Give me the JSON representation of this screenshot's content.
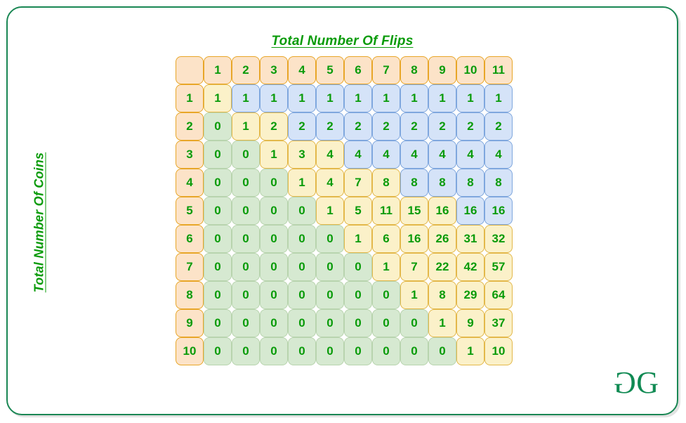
{
  "card": {
    "border_color": "#1a8754",
    "background": "#ffffff"
  },
  "titles": {
    "x_axis": "Total Number Of Flips",
    "y_axis": "Total Number Of Coins",
    "text_color": "#0a9b0a"
  },
  "logo": {
    "left_glyph": "G",
    "right_glyph": "G",
    "color": "#108a53"
  },
  "palette": {
    "header": "#fce3c8",
    "header_border": "#e8a628",
    "zero": "#d6e9d1",
    "zero_border": "#b8d4ae",
    "active": "#fbf1c9",
    "active_border": "#e3b84a",
    "saturated": "#d5e3f8",
    "saturated_border": "#7fa7de",
    "text": "#0a9b0a"
  },
  "chart_data": {
    "type": "table",
    "title": "Total Number Of Flips",
    "xlabel": "Total Number Of Flips",
    "ylabel": "Total Number Of Coins",
    "corner_label": "",
    "column_headers": [
      "1",
      "2",
      "3",
      "4",
      "5",
      "6",
      "7",
      "8",
      "9",
      "10",
      "11"
    ],
    "row_headers": [
      "1",
      "2",
      "3",
      "4",
      "5",
      "6",
      "7",
      "8",
      "9",
      "10"
    ],
    "rows": [
      {
        "coins": "1",
        "values": [
          "1",
          "1",
          "1",
          "1",
          "1",
          "1",
          "1",
          "1",
          "1",
          "1",
          "1"
        ],
        "kinds": [
          "active",
          "saturated",
          "saturated",
          "saturated",
          "saturated",
          "saturated",
          "saturated",
          "saturated",
          "saturated",
          "saturated",
          "saturated"
        ]
      },
      {
        "coins": "2",
        "values": [
          "0",
          "1",
          "2",
          "2",
          "2",
          "2",
          "2",
          "2",
          "2",
          "2",
          "2"
        ],
        "kinds": [
          "zero",
          "active",
          "active",
          "saturated",
          "saturated",
          "saturated",
          "saturated",
          "saturated",
          "saturated",
          "saturated",
          "saturated"
        ]
      },
      {
        "coins": "3",
        "values": [
          "0",
          "0",
          "1",
          "3",
          "4",
          "4",
          "4",
          "4",
          "4",
          "4",
          "4"
        ],
        "kinds": [
          "zero",
          "zero",
          "active",
          "active",
          "active",
          "saturated",
          "saturated",
          "saturated",
          "saturated",
          "saturated",
          "saturated"
        ]
      },
      {
        "coins": "4",
        "values": [
          "0",
          "0",
          "0",
          "1",
          "4",
          "7",
          "8",
          "8",
          "8",
          "8",
          "8"
        ],
        "kinds": [
          "zero",
          "zero",
          "zero",
          "active",
          "active",
          "active",
          "active",
          "saturated",
          "saturated",
          "saturated",
          "saturated"
        ]
      },
      {
        "coins": "5",
        "values": [
          "0",
          "0",
          "0",
          "0",
          "1",
          "5",
          "11",
          "15",
          "16",
          "16",
          "16"
        ],
        "kinds": [
          "zero",
          "zero",
          "zero",
          "zero",
          "active",
          "active",
          "active",
          "active",
          "active",
          "saturated",
          "saturated"
        ]
      },
      {
        "coins": "6",
        "values": [
          "0",
          "0",
          "0",
          "0",
          "0",
          "1",
          "6",
          "16",
          "26",
          "31",
          "32"
        ],
        "kinds": [
          "zero",
          "zero",
          "zero",
          "zero",
          "zero",
          "active",
          "active",
          "active",
          "active",
          "active",
          "active"
        ]
      },
      {
        "coins": "7",
        "values": [
          "0",
          "0",
          "0",
          "0",
          "0",
          "0",
          "1",
          "7",
          "22",
          "42",
          "57"
        ],
        "kinds": [
          "zero",
          "zero",
          "zero",
          "zero",
          "zero",
          "zero",
          "active",
          "active",
          "active",
          "active",
          "active"
        ]
      },
      {
        "coins": "8",
        "values": [
          "0",
          "0",
          "0",
          "0",
          "0",
          "0",
          "0",
          "1",
          "8",
          "29",
          "64"
        ],
        "kinds": [
          "zero",
          "zero",
          "zero",
          "zero",
          "zero",
          "zero",
          "zero",
          "active",
          "active",
          "active",
          "active"
        ]
      },
      {
        "coins": "9",
        "values": [
          "0",
          "0",
          "0",
          "0",
          "0",
          "0",
          "0",
          "0",
          "1",
          "9",
          "37"
        ],
        "kinds": [
          "zero",
          "zero",
          "zero",
          "zero",
          "zero",
          "zero",
          "zero",
          "zero",
          "active",
          "active",
          "active"
        ]
      },
      {
        "coins": "10",
        "values": [
          "0",
          "0",
          "0",
          "0",
          "0",
          "0",
          "0",
          "0",
          "0",
          "1",
          "10"
        ],
        "kinds": [
          "zero",
          "zero",
          "zero",
          "zero",
          "zero",
          "zero",
          "zero",
          "zero",
          "zero",
          "active",
          "active"
        ]
      }
    ]
  }
}
